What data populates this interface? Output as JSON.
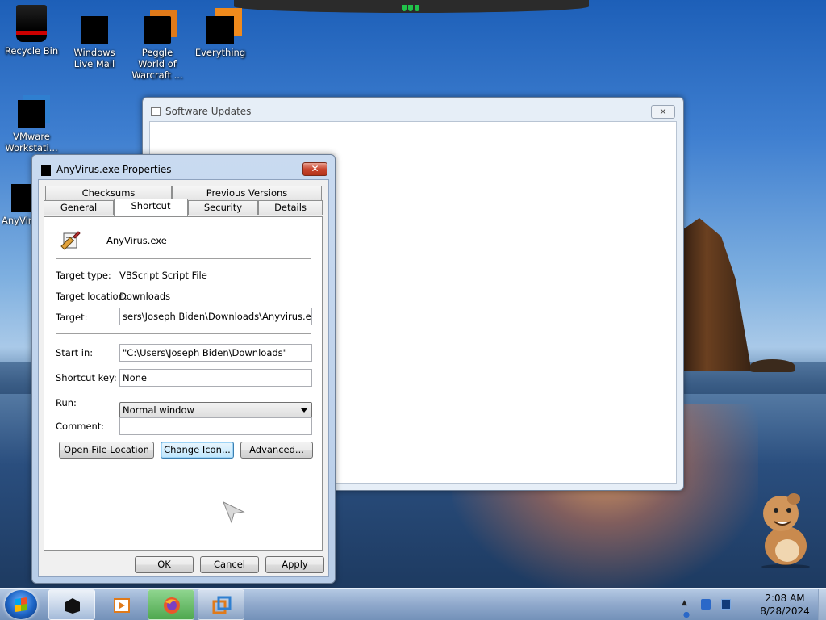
{
  "desktop": {
    "icons": [
      {
        "label": "Recycle Bin"
      },
      {
        "label": "Windows Live Mail"
      },
      {
        "label": "Peggle World of Warcraft ..."
      },
      {
        "label": "Everything"
      },
      {
        "label": "VMware Workstati..."
      },
      {
        "label": "AnyViru..."
      }
    ]
  },
  "software_updates": {
    "title": "Software Updates",
    "close_glyph": "✕"
  },
  "properties": {
    "title": "AnyVirus.exe Properties",
    "close_glyph": "✕",
    "tabs_row1": [
      "Checksums",
      "Previous Versions"
    ],
    "tabs_row2": [
      "General",
      "Shortcut",
      "Security",
      "Details"
    ],
    "active_tab": "Shortcut",
    "file_name": "AnyVirus.exe",
    "target_type_label": "Target type:",
    "target_type_value": "VBScript Script File",
    "target_location_label": "Target location:",
    "target_location_value": "Downloads",
    "target_label": "Target:",
    "target_value": "sers\\Joseph Biden\\Downloads\\Anyvirus.exe.vbs\"",
    "start_in_label": "Start in:",
    "start_in_value": "\"C:\\Users\\Joseph Biden\\Downloads\"",
    "shortcut_key_label": "Shortcut key:",
    "shortcut_key_value": "None",
    "run_label": "Run:",
    "run_value": "Normal window",
    "comment_label": "Comment:",
    "comment_value": "",
    "buttons": {
      "open_file_location": "Open File Location",
      "change_icon": "Change Icon...",
      "advanced": "Advanced...",
      "ok": "OK",
      "cancel": "Cancel",
      "apply": "Apply"
    }
  },
  "taskbar": {
    "time": "2:08 AM",
    "date": "8/28/2024",
    "tray_arrow": "▲"
  },
  "colors": {
    "accent": "#3c7fb1",
    "close_red": "#c9452e"
  }
}
